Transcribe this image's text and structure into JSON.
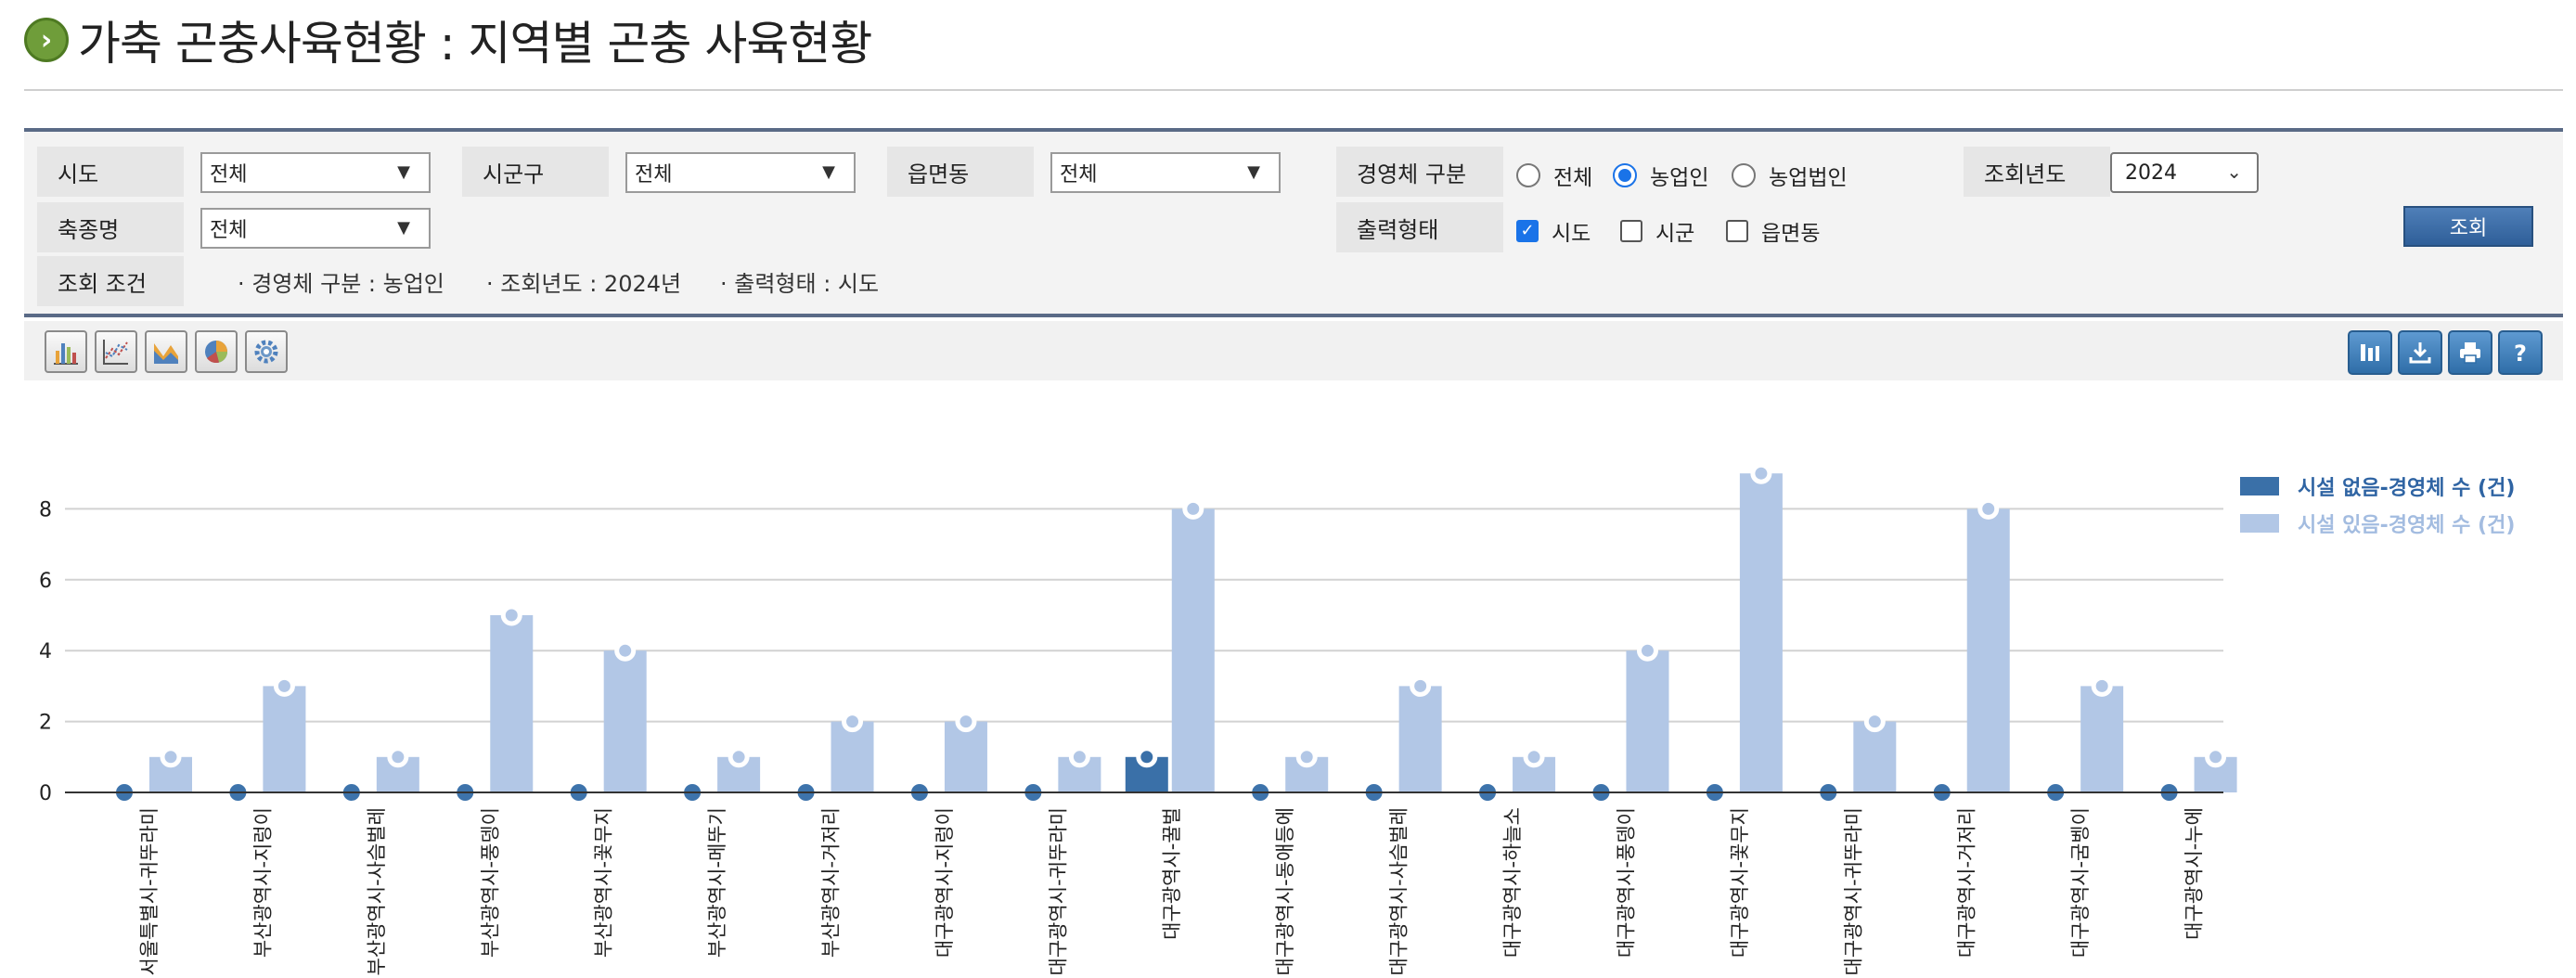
{
  "page": {
    "title": "가축 곤충사육현황 : 지역별 곤충 사육현황"
  },
  "filters": {
    "sido": {
      "label": "시도",
      "value": "전체"
    },
    "sigungu": {
      "label": "시군구",
      "value": "전체"
    },
    "eupmyeondong": {
      "label": "읍면동",
      "value": "전체"
    },
    "entity_type": {
      "label": "경영체 구분",
      "options": [
        "전체",
        "농업인",
        "농업법인"
      ],
      "selected": "농업인"
    },
    "year": {
      "label": "조회년도",
      "value": "2024"
    },
    "species": {
      "label": "축종명",
      "value": "전체"
    },
    "output": {
      "label": "출력형태",
      "options": [
        {
          "label": "시도",
          "checked": true
        },
        {
          "label": "시군",
          "checked": false
        },
        {
          "label": "읍면동",
          "checked": false
        }
      ]
    },
    "conditions": {
      "label": "조회 조건",
      "items": [
        "· 경영체 구분 : 농업인",
        "· 조회년도 : 2024년",
        "· 출력형태 : 시도"
      ]
    },
    "search_label": "조회"
  },
  "toolbar": {
    "left_icons": [
      "bar-chart-icon",
      "scatter-chart-icon",
      "area-chart-icon",
      "pie-chart-icon",
      "settings-icon"
    ],
    "right_icons": [
      "column-view-icon",
      "download-icon",
      "print-icon",
      "help-icon"
    ]
  },
  "colors": {
    "series_dark": "#3a70a8",
    "series_light": "#b2c7e6",
    "accent": "#4e7fb5"
  },
  "chart_data": {
    "type": "bar",
    "categories": [
      "서울특별시-귀뚜라미",
      "부산광역시-지렁이",
      "부산광역시-사슴벌레",
      "부산광역시-풍뎅이",
      "부산광역시-꽃무지",
      "부산광역시-메뚜기",
      "부산광역시-거저리",
      "대구광역시-지렁이",
      "대구광역시-귀뚜라미",
      "대구광역시-꿀벌",
      "대구광역시-동애등에",
      "대구광역시-사슴벌레",
      "대구광역시-하늘소",
      "대구광역시-풍뎅이",
      "대구광역시-꽃무지",
      "대구광역시-귀뚜라미",
      "대구광역시-거저리",
      "대구광역시-굼벵이",
      "대구광역시-누에"
    ],
    "series": [
      {
        "name": "시설 없음-경영체 수 (건)",
        "values": [
          0,
          0,
          0,
          0,
          0,
          0,
          0,
          0,
          0,
          1,
          0,
          0,
          0,
          0,
          0,
          0,
          0,
          0,
          0
        ]
      },
      {
        "name": "시설 있음-경영체 수 (건)",
        "values": [
          1,
          3,
          1,
          5,
          4,
          1,
          2,
          2,
          1,
          8,
          1,
          3,
          1,
          4,
          9,
          2,
          8,
          3,
          1
        ]
      }
    ],
    "yticks": [
      0,
      2,
      4,
      6,
      8
    ],
    "ylim": [
      0,
      9
    ],
    "grid": true,
    "legend_position": "top-right"
  }
}
